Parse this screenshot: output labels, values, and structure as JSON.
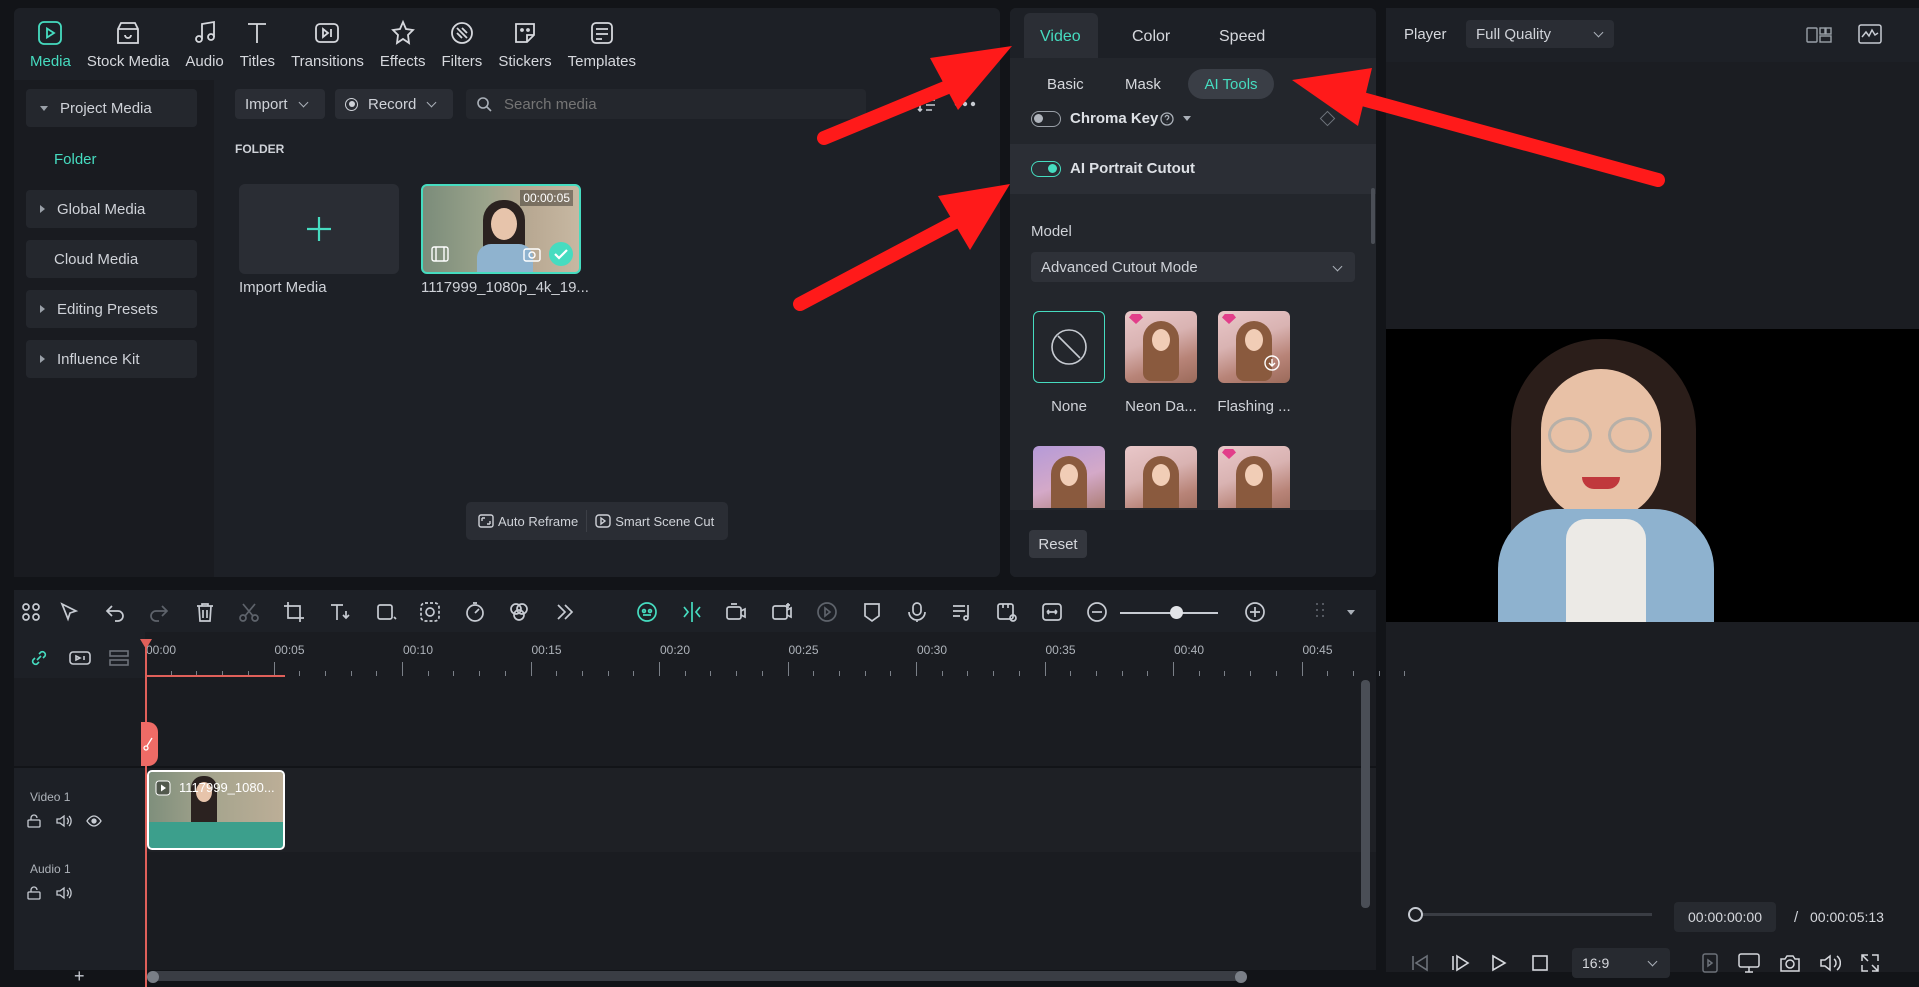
{
  "nav": [
    {
      "label": "Media",
      "icon": "media-icon",
      "active": true
    },
    {
      "label": "Stock Media",
      "icon": "stock-media-icon"
    },
    {
      "label": "Audio",
      "icon": "audio-icon"
    },
    {
      "label": "Titles",
      "icon": "titles-icon"
    },
    {
      "label": "Transitions",
      "icon": "transitions-icon"
    },
    {
      "label": "Effects",
      "icon": "effects-icon"
    },
    {
      "label": "Filters",
      "icon": "filters-icon"
    },
    {
      "label": "Stickers",
      "icon": "stickers-icon"
    },
    {
      "label": "Templates",
      "icon": "templates-icon"
    }
  ],
  "sidebar": {
    "items": [
      "Project Media",
      "Folder",
      "Global Media",
      "Cloud Media",
      "Editing Presets",
      "Influence Kit"
    ]
  },
  "media": {
    "import_label": "Import",
    "record_label": "Record",
    "search_placeholder": "Search media",
    "folder_heading": "FOLDER",
    "import_media_label": "Import Media",
    "clip_name": "1117999_1080p_4k_19...",
    "clip_duration": "00:00:05",
    "auto_reframe": "Auto Reframe",
    "smart_scene_cut": "Smart Scene Cut"
  },
  "props": {
    "tabs": [
      "Video",
      "Color",
      "Speed"
    ],
    "subtabs": [
      "Basic",
      "Mask",
      "AI Tools"
    ],
    "chroma_key": "Chroma Key",
    "ai_portrait": "AI Portrait Cutout",
    "model_label": "Model",
    "model_value": "Advanced Cutout Mode",
    "effects": [
      "None",
      "Neon Da...",
      "Flashing ..."
    ],
    "reset": "Reset"
  },
  "timeline": {
    "ticks": [
      "00:00",
      "00:05",
      "00:10",
      "00:15",
      "00:20",
      "00:25",
      "00:30",
      "00:35",
      "00:40",
      "00:45"
    ],
    "video_track": "Video 1",
    "audio_track": "Audio 1",
    "clip_label": "1117999_1080..."
  },
  "player": {
    "label": "Player",
    "quality": "Full Quality",
    "current_time": "00:00:00:00",
    "separator": "/",
    "total_time": "00:00:05:13",
    "ratio": "16:9"
  },
  "colors": {
    "accent": "#46dcc0",
    "annotation": "#ff1a1a"
  }
}
